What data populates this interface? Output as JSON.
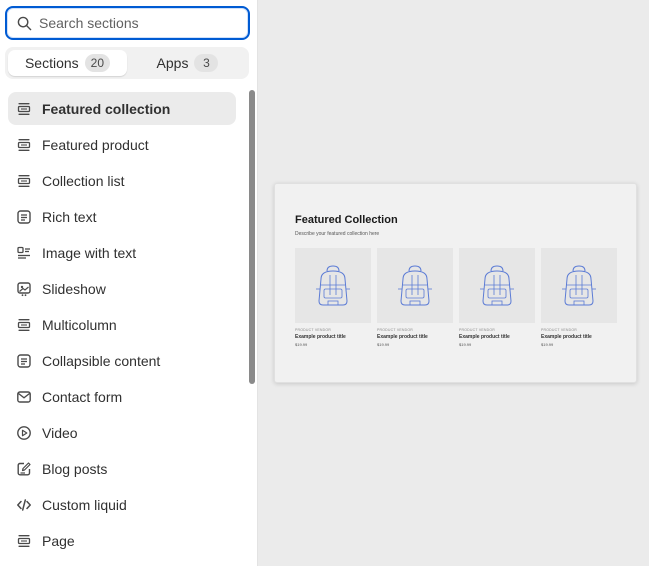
{
  "search": {
    "placeholder": "Search sections",
    "value": ""
  },
  "tabs": [
    {
      "label": "Sections",
      "count": "20",
      "active": true
    },
    {
      "label": "Apps",
      "count": "3",
      "active": false
    }
  ],
  "sections": [
    {
      "label": "Featured collection",
      "icon": "section-icon",
      "selected": true
    },
    {
      "label": "Featured product",
      "icon": "section-icon"
    },
    {
      "label": "Collection list",
      "icon": "section-icon"
    },
    {
      "label": "Rich text",
      "icon": "text-block-icon"
    },
    {
      "label": "Image with text",
      "icon": "image-text-icon"
    },
    {
      "label": "Slideshow",
      "icon": "slideshow-icon"
    },
    {
      "label": "Multicolumn",
      "icon": "section-icon"
    },
    {
      "label": "Collapsible content",
      "icon": "text-block-icon"
    },
    {
      "label": "Contact form",
      "icon": "envelope-icon"
    },
    {
      "label": "Video",
      "icon": "play-icon"
    },
    {
      "label": "Blog posts",
      "icon": "edit-icon"
    },
    {
      "label": "Custom liquid",
      "icon": "code-icon"
    },
    {
      "label": "Page",
      "icon": "section-icon"
    }
  ],
  "preview": {
    "title": "Featured Collection",
    "description": "Describe your featured collection here",
    "products": [
      {
        "vendor": "PRODUCT VENDOR",
        "title": "Example product title",
        "price": "$19.99"
      },
      {
        "vendor": "PRODUCT VENDOR",
        "title": "Example product title",
        "price": "$19.99"
      },
      {
        "vendor": "PRODUCT VENDOR",
        "title": "Example product title",
        "price": "$19.99"
      },
      {
        "vendor": "PRODUCT VENDOR",
        "title": "Example product title",
        "price": "$19.99"
      }
    ]
  },
  "colors": {
    "focus_ring": "#005bd3",
    "selected_bg": "#ebebeb",
    "canvas_bg": "#ebebeb",
    "placeholder_line": "#5b7bd5"
  }
}
